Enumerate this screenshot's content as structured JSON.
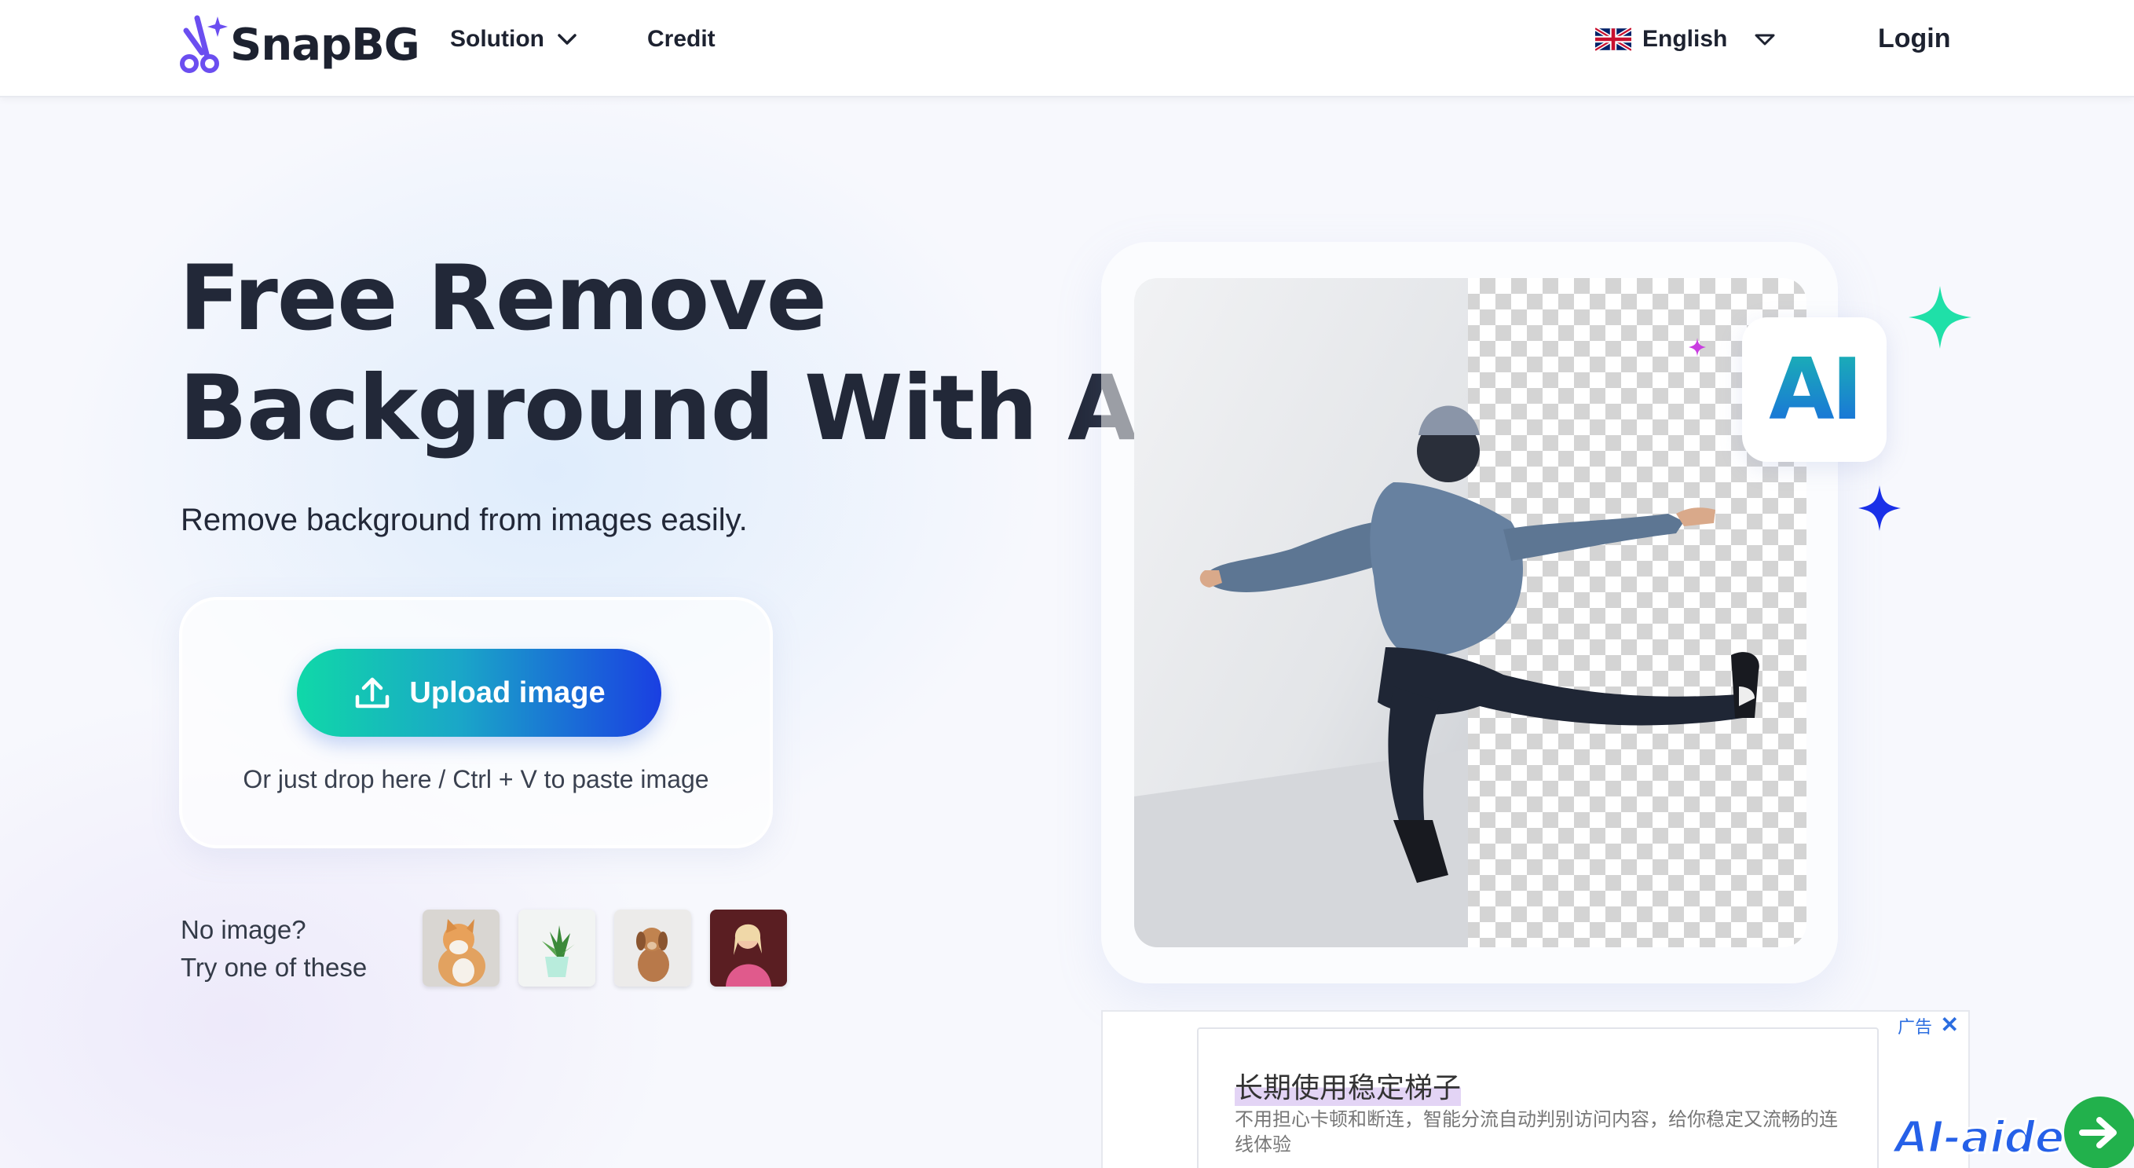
{
  "header": {
    "brand": "SnapBG",
    "nav": {
      "solution": "Solution",
      "credit": "Credit"
    },
    "language": "English",
    "login": "Login"
  },
  "hero": {
    "title_line1": "Free Remove",
    "title_line2": "Background With AI",
    "subtitle": "Remove background from images easily.",
    "badge": "AI"
  },
  "upload": {
    "button_label": "Upload image",
    "drop_hint": "Or just drop here / Ctrl + V to paste image"
  },
  "samples": {
    "prompt_line1": "No image?",
    "prompt_line2": "Try one of these",
    "items": [
      "cat",
      "potted-plant",
      "puppy",
      "woman"
    ]
  },
  "ad": {
    "label": "广告",
    "close": "✕",
    "title": "长期使用稳定梯子",
    "description": "不用担心卡顿和断连，智能分流自动判别访问内容，给你稳定又流畅的连线体验"
  },
  "watermark": "AI-aide",
  "colors": {
    "brand_purple": "#6b4ef0",
    "button_start": "#10d8a8",
    "button_end": "#1a3fe2",
    "sparkle_green": "#1fe0a8",
    "sparkle_blue": "#1a30e8",
    "sparkle_pink": "#c93de0",
    "ad_link": "#2b6de0",
    "fab_green": "#22b14c"
  }
}
